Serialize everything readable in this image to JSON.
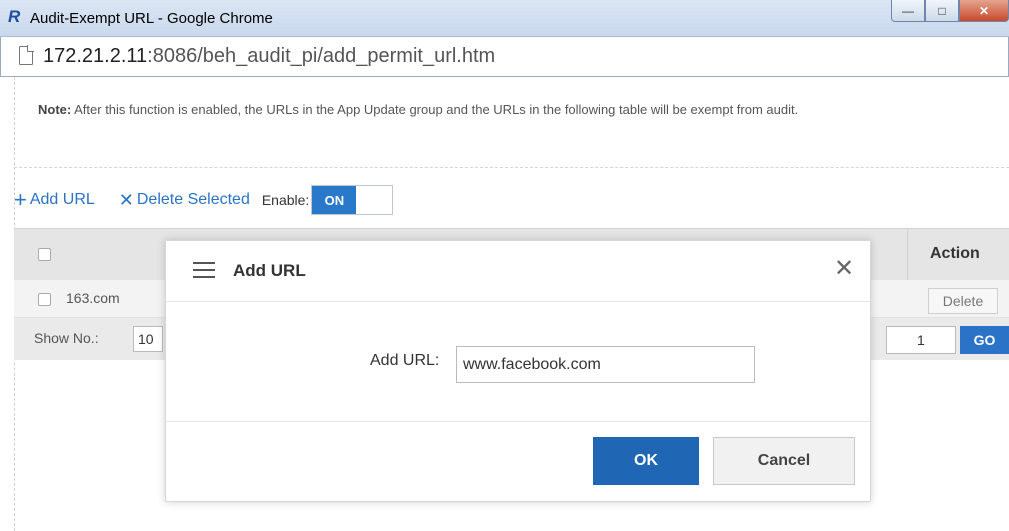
{
  "window": {
    "title": "Audit-Exempt URL - Google Chrome",
    "logo_glyph": "R",
    "controls": {
      "minimize": "—",
      "maximize": "□",
      "close": "✕"
    }
  },
  "address_bar": {
    "host": "172.21.2.11",
    "rest": ":8086/beh_audit_pi/add_permit_url.htm"
  },
  "note": {
    "label": "Note:",
    "text": "After this function is enabled, the URLs in the App Update group and the URLs in the following table will be exempt from audit."
  },
  "toolbar": {
    "add_icon": "+",
    "add_label": "Add URL",
    "delete_icon": "✕",
    "delete_label": "Delete Selected",
    "enable_label": "Enable:",
    "toggle_state": "ON"
  },
  "table": {
    "header_action": "Action",
    "rows": [
      {
        "url": "163.com",
        "action": "Delete"
      }
    ],
    "footer": {
      "show_no_label": "Show No.:",
      "show_no_value": "10",
      "page_value": "1",
      "go_label": "GO"
    }
  },
  "modal": {
    "title": "Add URL",
    "close_glyph": "✕",
    "field_label": "Add URL:",
    "field_value": "www.facebook.com",
    "ok_label": "OK",
    "cancel_label": "Cancel"
  },
  "colors": {
    "accent": "#2b73c6",
    "ok_button": "#1f67b5",
    "toggle_on": "#2a78c9"
  }
}
